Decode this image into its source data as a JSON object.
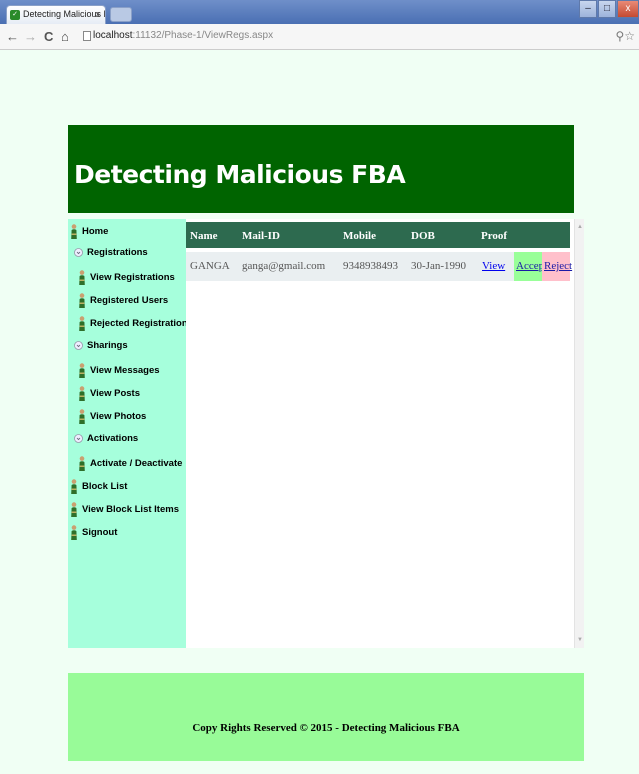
{
  "browser": {
    "tab_title": "Detecting Malicious FBA",
    "tab_close": "x",
    "url_host": "localhost",
    "url_path": ":11132/Phase-1/ViewRegs.aspx",
    "nav_back": "←",
    "nav_forward": "→",
    "nav_reload": "C",
    "nav_home": "⌂",
    "right_icons": "⚲☆"
  },
  "header": {
    "title": "Detecting Malicious FBA"
  },
  "sidebar": {
    "items": [
      {
        "label": "Home",
        "icon": "person-icon"
      },
      {
        "label": "Registrations",
        "icon": "expand-icon"
      },
      {
        "label": "View Registrations",
        "icon": "person-icon"
      },
      {
        "label": "Registered Users",
        "icon": "person-icon"
      },
      {
        "label": "Rejected Registrations",
        "icon": "person-icon"
      },
      {
        "label": "Sharings",
        "icon": "expand-icon"
      },
      {
        "label": "View Messages",
        "icon": "person-icon"
      },
      {
        "label": "View Posts",
        "icon": "person-icon"
      },
      {
        "label": "View Photos",
        "icon": "person-icon"
      },
      {
        "label": "Activations",
        "icon": "expand-icon"
      },
      {
        "label": "Activate / Deactivate",
        "icon": "person-icon"
      },
      {
        "label": "Block List",
        "icon": "person-icon"
      },
      {
        "label": "View Block List Items",
        "icon": "person-icon"
      },
      {
        "label": "Signout",
        "icon": "person-icon"
      }
    ]
  },
  "grid": {
    "columns": [
      "Name",
      "Mail-ID",
      "Mobile",
      "DOB",
      "Proof"
    ],
    "rows": [
      {
        "name": "GANGA",
        "mail": "ganga@gmail.com",
        "mobile": "9348938493",
        "dob": "30-Jan-1990",
        "proof": "View",
        "accept": "Accept",
        "reject": "Reject"
      }
    ]
  },
  "footer": {
    "text": "Copy Rights Reserved © 2015 - Detecting Malicious FBA"
  },
  "colors": {
    "header_bg": "#006400",
    "sidebar_bg": "#a6ffdc",
    "grid_header_bg": "#2d6a4f",
    "footer_bg": "#98fb98",
    "accept_bg": "#99ff99",
    "reject_bg": "#ffc0cb"
  }
}
